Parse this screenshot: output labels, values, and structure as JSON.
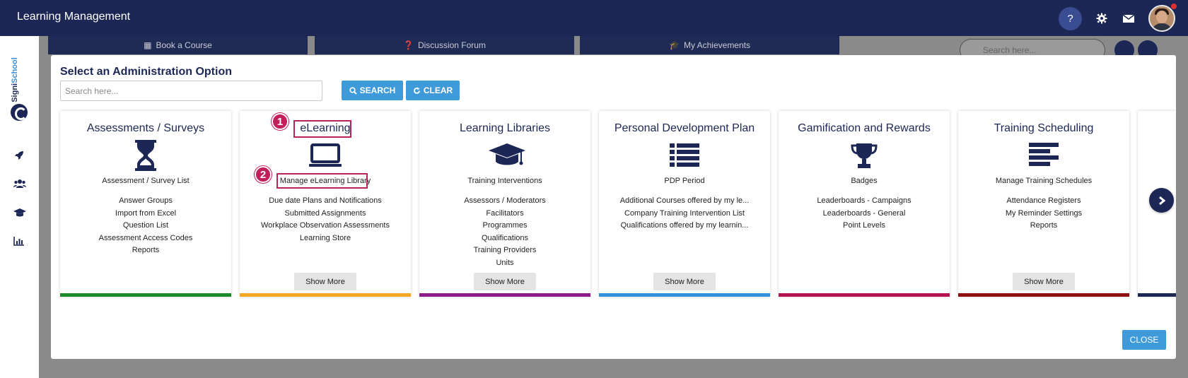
{
  "topbar": {
    "title": "Learning Management",
    "help_label": "?",
    "icons": [
      "gear-icon",
      "mail-icon",
      "avatar"
    ]
  },
  "sidebar": {
    "logo": {
      "signi": "Signi",
      "school": "School"
    },
    "icons": [
      "rocket-icon",
      "users-icon",
      "graduation-cap-icon",
      "bar-chart-icon"
    ]
  },
  "background": {
    "tabs": [
      {
        "label": "Book a Course",
        "icon": "calendar-icon"
      },
      {
        "label": "Discussion Forum",
        "icon": "question-circle-icon"
      },
      {
        "label": "My Achievements",
        "icon": "graduation-cap-icon"
      }
    ],
    "search_placeholder": "Search here..."
  },
  "modal": {
    "title": "Select an Administration Option",
    "search_placeholder": "Search here...",
    "search_label": "SEARCH",
    "clear_label": "CLEAR",
    "close_label": "CLOSE",
    "cards": [
      {
        "title": "Assessments / Surveys",
        "icon": "hourglass-icon",
        "main_link": "Assessment / Survey List",
        "links": [
          "Answer Groups",
          "Import from Excel",
          "Question List",
          "Assessment Access Codes",
          "Reports"
        ],
        "show_more": "",
        "bar_color": "#1a8a2a"
      },
      {
        "title": "eLearning",
        "icon": "laptop-icon",
        "main_link": "Manage eLearning Library",
        "links": [
          "Due date Plans and Notifications",
          "Submitted Assignments",
          "Workplace Observation Assessments",
          "Learning Store"
        ],
        "show_more": "Show More",
        "bar_color": "#f5a623"
      },
      {
        "title": "Learning Libraries",
        "icon": "graduation-cap-icon",
        "main_link": "Training Interventions",
        "links": [
          "Assessors / Moderators",
          "Facilitators",
          "Programmes",
          "Qualifications",
          "Training Providers",
          "Units"
        ],
        "show_more": "Show More",
        "bar_color": "#8e1b8e"
      },
      {
        "title": "Personal Development Plan",
        "icon": "list-icon",
        "main_link": "PDP Period",
        "links": [
          "Additional Courses offered by my le...",
          "Company Training Intervention List",
          "Qualifications offered by my learnin..."
        ],
        "show_more": "Show More",
        "bar_color": "#3391dc"
      },
      {
        "title": "Gamification and Rewards",
        "icon": "trophy-icon",
        "main_link": "Badges",
        "links": [
          "Leaderboards - Campaigns",
          "Leaderboards - General",
          "Point Levels"
        ],
        "show_more": "",
        "bar_color": "#b5134f"
      },
      {
        "title": "Training Scheduling",
        "icon": "align-left-icon",
        "main_link": "Manage Training Schedules",
        "links": [
          "Attendance Registers",
          "My Reminder Settings",
          "Reports"
        ],
        "show_more": "Show More",
        "bar_color": "#8f1010"
      }
    ],
    "partial_card_bar_color": "#1c2755",
    "annotations": [
      "1",
      "2"
    ]
  }
}
